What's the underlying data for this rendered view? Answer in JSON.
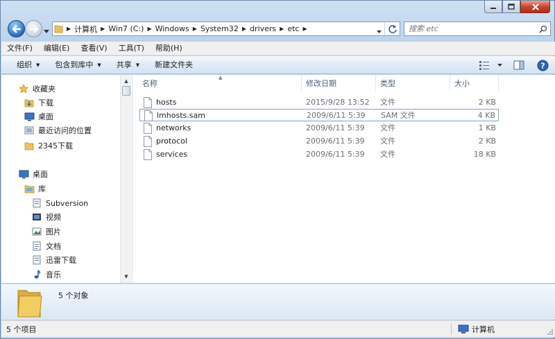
{
  "window": {
    "caption_buttons": [
      "minimize",
      "maximize",
      "close"
    ]
  },
  "nav": {
    "breadcrumb": [
      "计算机",
      "Win7 (C:)",
      "Windows",
      "System32",
      "drivers",
      "etc"
    ],
    "search_placeholder": "搜索 etc"
  },
  "menubar": {
    "items": [
      "文件(F)",
      "编辑(E)",
      "查看(V)",
      "工具(T)",
      "帮助(H)"
    ]
  },
  "toolbar": {
    "organize": "组织",
    "include_library": "包含到库中",
    "share": "共享",
    "new_folder": "新建文件夹"
  },
  "sidebar": {
    "favorites": {
      "label": "收藏夹",
      "icon": "star-icon"
    },
    "fav_items": [
      {
        "label": "下载",
        "icon": "download-folder-icon"
      },
      {
        "label": "桌面",
        "icon": "desktop-icon"
      },
      {
        "label": "最近访问的位置",
        "icon": "recent-places-icon"
      },
      {
        "label": "2345下载",
        "icon": "folder-icon"
      }
    ],
    "desktop": {
      "label": "桌面",
      "icon": "desktop-icon"
    },
    "library": {
      "label": "库",
      "icon": "library-icon"
    },
    "lib_items": [
      {
        "label": "Subversion",
        "icon": "library-item-icon"
      },
      {
        "label": "视频",
        "icon": "video-icon"
      },
      {
        "label": "图片",
        "icon": "picture-icon"
      },
      {
        "label": "文档",
        "icon": "document-icon"
      },
      {
        "label": "迅雷下载",
        "icon": "library-item-icon"
      },
      {
        "label": "音乐",
        "icon": "music-icon"
      }
    ]
  },
  "columns": {
    "name": "名称",
    "date": "修改日期",
    "type": "类型",
    "size": "大小"
  },
  "files": [
    {
      "name": "hosts",
      "date": "2015/9/28 13:52",
      "type": "文件",
      "size": "2 KB"
    },
    {
      "name": "lmhosts.sam",
      "date": "2009/6/11 5:39",
      "type": "SAM 文件",
      "size": "4 KB"
    },
    {
      "name": "networks",
      "date": "2009/6/11 5:39",
      "type": "文件",
      "size": "1 KB"
    },
    {
      "name": "protocol",
      "date": "2009/6/11 5:39",
      "type": "文件",
      "size": "2 KB"
    },
    {
      "name": "services",
      "date": "2009/6/11 5:39",
      "type": "文件",
      "size": "18 KB"
    }
  ],
  "details": {
    "text": "5 个对象"
  },
  "status": {
    "left": "5 个项目",
    "right": "计算机"
  }
}
